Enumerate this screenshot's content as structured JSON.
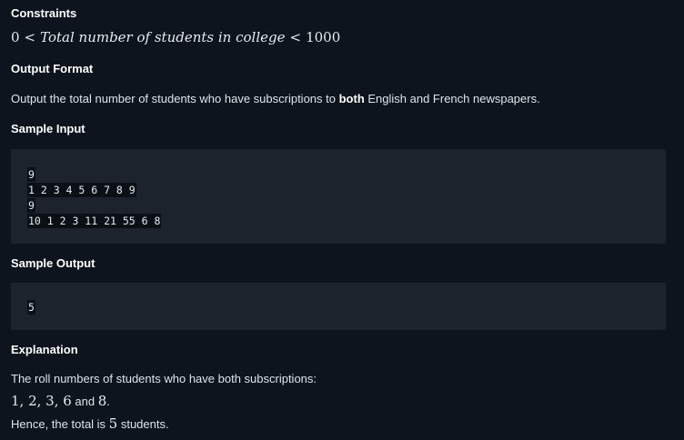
{
  "constraints": {
    "heading": "Constraints",
    "math_lhs": "0",
    "math_op1": "<",
    "math_text": "Total number of students in college",
    "math_op2": "<",
    "math_rhs": "1000"
  },
  "output_format": {
    "heading": "Output Format",
    "text_before": "Output the total number of students who have subscriptions to ",
    "text_bold": "both",
    "text_after": " English and French newspapers."
  },
  "sample_input": {
    "heading": "Sample Input",
    "lines": [
      "9",
      "1 2 3 4 5 6 7 8 9",
      "9",
      "10 1 2 3 11 21 55 6 8"
    ]
  },
  "sample_output": {
    "heading": "Sample Output",
    "lines": [
      "5"
    ]
  },
  "explanation": {
    "heading": "Explanation",
    "line1": "The roll numbers of students who have both subscriptions:",
    "line2_math": "1, 2, 3, 6",
    "line2_and": " and ",
    "line2_math_end": "8",
    "line2_period": ".",
    "line3_before": "Hence, the total is ",
    "line3_math": "5",
    "line3_after": " students."
  }
}
